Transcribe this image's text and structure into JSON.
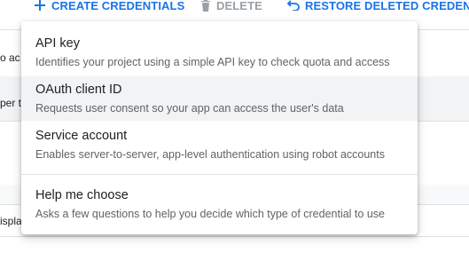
{
  "toolbar": {
    "create_label": "CREATE CREDENTIALS",
    "delete_label": "DELETE",
    "restore_label": "RESTORE DELETED CREDENTIALS",
    "accent_color": "#1a73e8",
    "disabled_color": "#9aa0a6",
    "create_icon": "plus-icon",
    "delete_icon": "trash-icon",
    "restore_icon": "undo-icon"
  },
  "background": {
    "row1_text": "o ac",
    "row2_text": "per t",
    "row3_text": "ispla"
  },
  "menu": {
    "items": [
      {
        "title": "API key",
        "description": "Identifies your project using a simple API key to check quota and access"
      },
      {
        "title": "OAuth client ID",
        "description": "Requests user consent so your app can access the user's data"
      },
      {
        "title": "Service account",
        "description": "Enables server-to-server, app-level authentication using robot accounts"
      },
      {
        "title": "Help me choose",
        "description": "Asks a few questions to help you decide which type of credential to use"
      }
    ],
    "highlighted_item": "OAuth client ID"
  }
}
